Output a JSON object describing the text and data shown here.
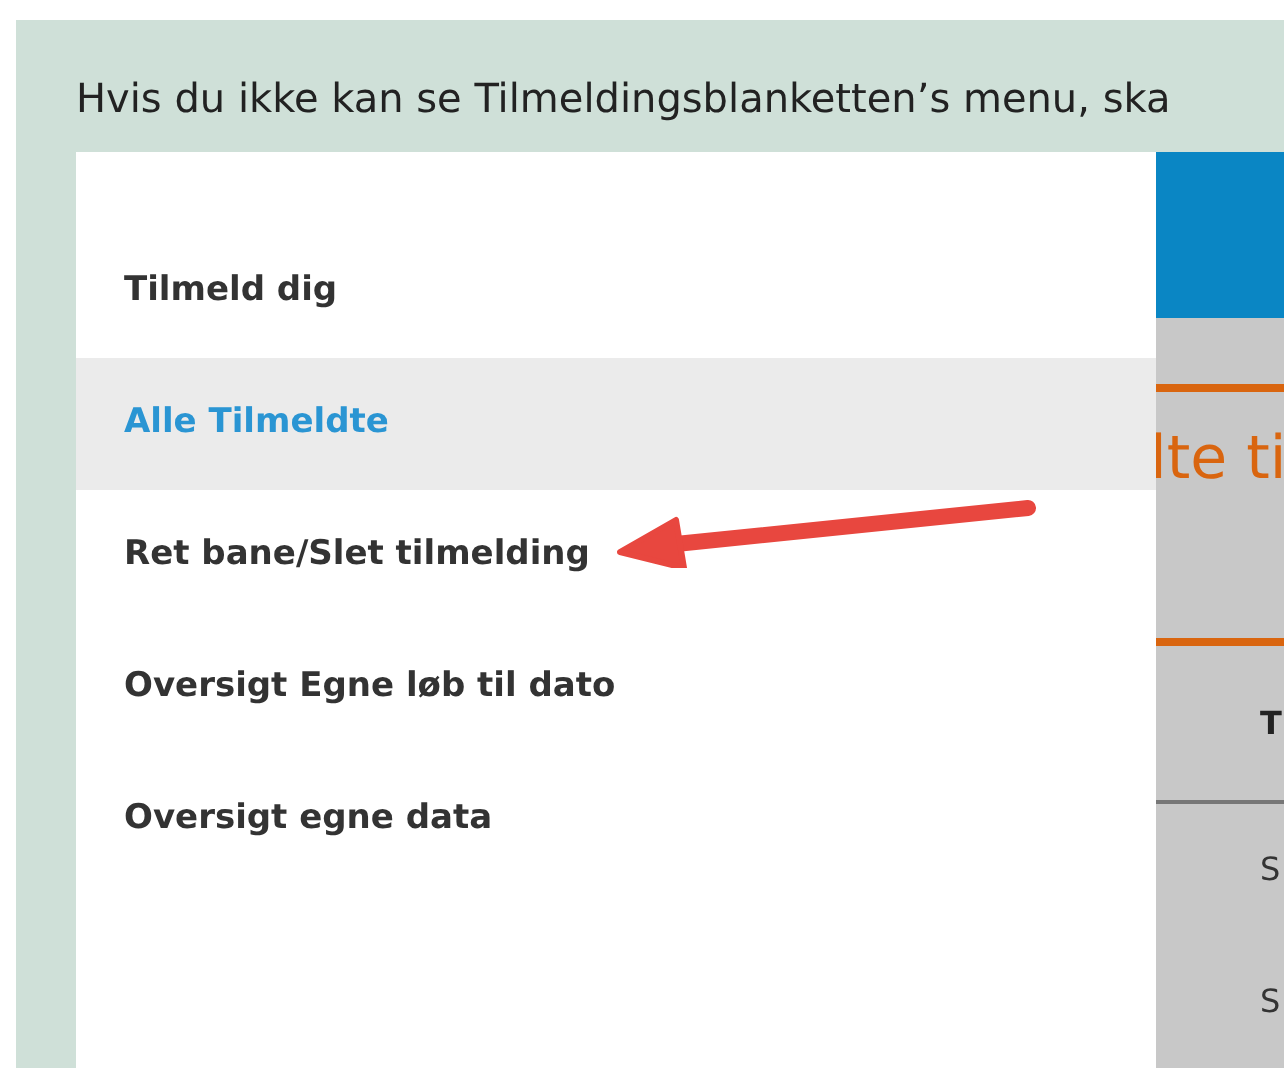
{
  "instruction": "Hvis du ikke kan se Tilmeldingsblanketten’s menu, ska",
  "menu": {
    "items": [
      {
        "label": "Tilmeld dig",
        "selected": false
      },
      {
        "label": "Alle Tilmeldte",
        "selected": true
      },
      {
        "label": "Ret bane/Slet tilmelding",
        "selected": false
      },
      {
        "label": "Oversigt Egne løb til dato",
        "selected": false
      },
      {
        "label": "Oversigt egne data",
        "selected": false
      }
    ]
  },
  "background_page": {
    "heading": "lte ti",
    "table": {
      "column_1": "T",
      "cells": [
        "S",
        "S"
      ]
    }
  }
}
